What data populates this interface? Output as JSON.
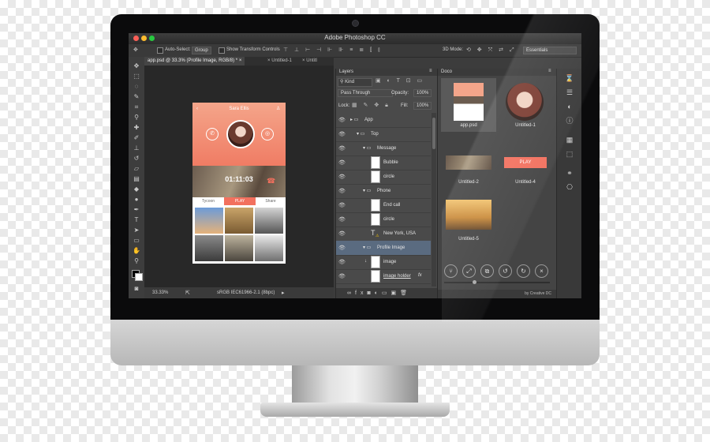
{
  "app": {
    "title": "Adobe Photoshop CC"
  },
  "options_bar": {
    "auto_select_label": "Auto-Select:",
    "auto_select_value": "Group",
    "show_transform_label": "Show Transform Controls",
    "mode_label": "3D Mode:",
    "workspace": "Essentials"
  },
  "tabs": [
    {
      "label": "app.psd @ 33.3% (Profile Image, RGB/8) *"
    },
    {
      "label": "Untitled-1"
    },
    {
      "label": "Untitl"
    }
  ],
  "document": {
    "contact_name": "Sara Ellis",
    "call_timer": "01:11:03",
    "left_tab": "Tycoon",
    "play_label": "PLAY",
    "right_tab": "Share"
  },
  "status": {
    "zoom": "33.33%",
    "color_profile": "sRGB IEC61966-2.1 (8bpc)"
  },
  "layers_panel": {
    "title": "Layers",
    "kind_label": "Kind",
    "blend_mode": "Pass Through",
    "opacity_label": "Opacity:",
    "opacity_value": "100%",
    "lock_label": "Lock:",
    "fill_label": "Fill:",
    "fill_value": "100%",
    "layers": [
      {
        "name": "App",
        "type": "group",
        "indent": 0
      },
      {
        "name": "Top",
        "type": "group",
        "indent": 1
      },
      {
        "name": "Message",
        "type": "group",
        "indent": 2
      },
      {
        "name": "Bubble",
        "type": "layer",
        "indent": 3
      },
      {
        "name": "circle",
        "type": "layer",
        "indent": 3
      },
      {
        "name": "Phone",
        "type": "group",
        "indent": 2
      },
      {
        "name": "End call",
        "type": "layer",
        "indent": 3
      },
      {
        "name": "circle",
        "type": "layer",
        "indent": 3
      },
      {
        "name": "New York, USA",
        "type": "text",
        "indent": 3
      },
      {
        "name": "Profile Image",
        "type": "group",
        "indent": 2,
        "selected": true
      },
      {
        "name": "image",
        "type": "layer",
        "indent": 3
      },
      {
        "name": "image holder",
        "type": "layer",
        "indent": 3,
        "fx": "fx"
      }
    ]
  },
  "doco_panel": {
    "title": "Doco",
    "items": [
      {
        "label": "app.psd"
      },
      {
        "label": "Untitled-1"
      },
      {
        "label": "Untitled-2"
      },
      {
        "label": "Untitled-4",
        "button": "PLAY"
      },
      {
        "label": "Untitled-5"
      }
    ],
    "footer": "by Creative DC"
  },
  "colors": {
    "accent": "#f2705e",
    "panel": "#4a4a4a",
    "selection": "#5a6b80"
  }
}
